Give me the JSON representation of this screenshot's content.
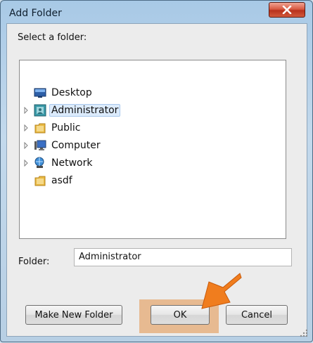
{
  "window": {
    "title": "Add Folder"
  },
  "dialog": {
    "prompt": "Select a folder:",
    "folder_label": "Folder:",
    "folder_value": "Administrator"
  },
  "tree": {
    "items": [
      {
        "label": "Desktop",
        "icon": "desktop-icon",
        "expander": false,
        "selected": false
      },
      {
        "label": "Administrator",
        "icon": "user-folder-icon",
        "expander": true,
        "selected": true
      },
      {
        "label": "Public",
        "icon": "folder-icon",
        "expander": true,
        "selected": false
      },
      {
        "label": "Computer",
        "icon": "computer-icon",
        "expander": true,
        "selected": false
      },
      {
        "label": "Network",
        "icon": "network-icon",
        "expander": true,
        "selected": false
      },
      {
        "label": "asdf",
        "icon": "folder-icon",
        "expander": false,
        "selected": false
      }
    ]
  },
  "buttons": {
    "make_new_folder": "Make New Folder",
    "ok": "OK",
    "cancel": "Cancel"
  },
  "colors": {
    "highlight": "#e7ba91",
    "arrow": "#f07d1e",
    "selection": "#dcebfc"
  }
}
